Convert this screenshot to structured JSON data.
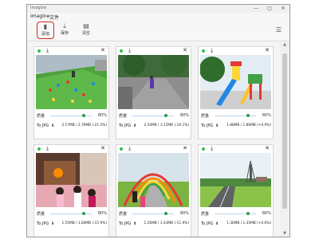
{
  "window": {
    "title": "Imagine",
    "minimize": "—",
    "maximize": "□",
    "close": "✕"
  },
  "menu": [
    "Imagine",
    "文件"
  ],
  "toolbar": {
    "buttons": [
      {
        "label": "添加",
        "icon": "add-file-icon"
      },
      {
        "label": "保存",
        "icon": "download-icon"
      },
      {
        "label": "清空",
        "icon": "clear-icon"
      }
    ],
    "filter_icon": "sliders-icon"
  },
  "colors": {
    "accent": "#e02020",
    "status": "#2ec24a",
    "slider": "#2d9b47"
  },
  "cards": [
    {
      "quality_label": "质量",
      "quality": "80%",
      "quality_value": 0.8,
      "format": "To JPG",
      "size": "2.17MB / 2.76MB (-21.5%)",
      "scene": "climbing-wall"
    },
    {
      "quality_label": "质量",
      "quality": "80%",
      "quality_value": 0.8,
      "format": "To JPG",
      "size": "2.54MB / 3.15MB (-19.1%)",
      "scene": "park-path"
    },
    {
      "quality_label": "质量",
      "quality": "80%",
      "quality_value": 0.8,
      "format": "To JPG",
      "size": "1.88MB / 1.86MB (+0.9%)",
      "scene": "playground"
    },
    {
      "quality_label": "质量",
      "quality": "80%",
      "quality_value": 0.8,
      "format": "To JPG",
      "size": "1.55MB / 1.84MB (-15.9%)",
      "scene": "kids-room"
    },
    {
      "quality_label": "质量",
      "quality": "80%",
      "quality_value": 0.8,
      "format": "To JPG",
      "size": "1.26MB / 1.43MB (-11.9%)",
      "scene": "arches"
    },
    {
      "quality_label": "质量",
      "quality": "80%",
      "quality_value": 0.8,
      "format": "To JPG",
      "size": "1.36MB / 1.35MB (+0.6%)",
      "scene": "road-tower"
    }
  ]
}
